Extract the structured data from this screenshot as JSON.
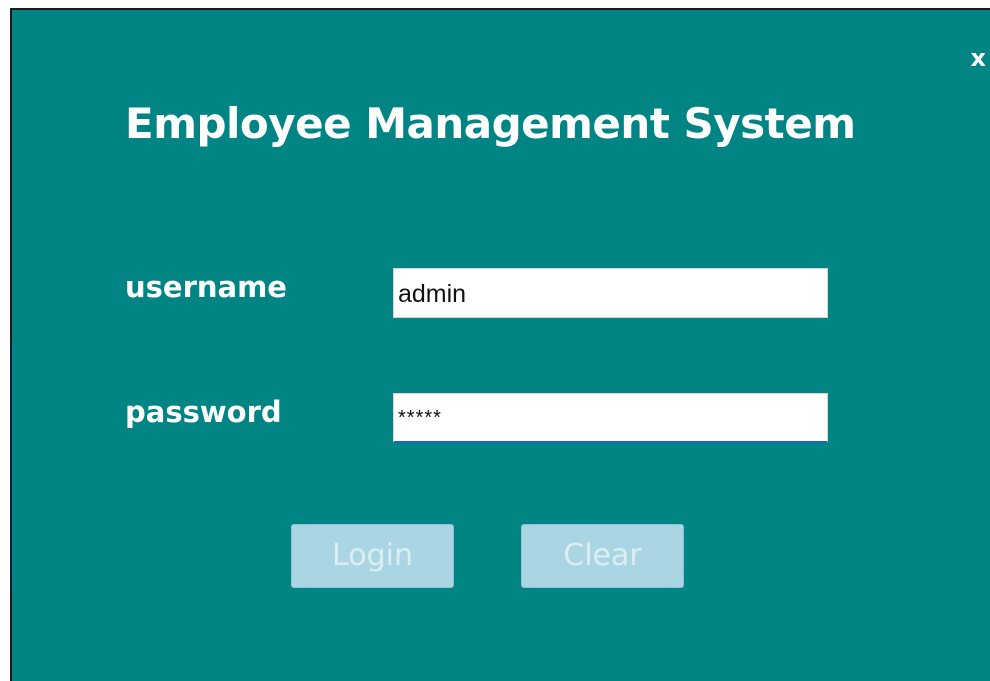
{
  "window": {
    "close_label": "x",
    "title": "Employee Management System"
  },
  "form": {
    "username_label": "username",
    "username_value": "admin",
    "password_label": "password",
    "password_value": "*****"
  },
  "buttons": {
    "login_label": "Login",
    "clear_label": "Clear"
  },
  "colors": {
    "background": "#008584",
    "text": "#ffffff",
    "button_fill": "#a9d6e2",
    "button_text": "#dceef3",
    "input_focus_underline": "#1c63d6"
  }
}
